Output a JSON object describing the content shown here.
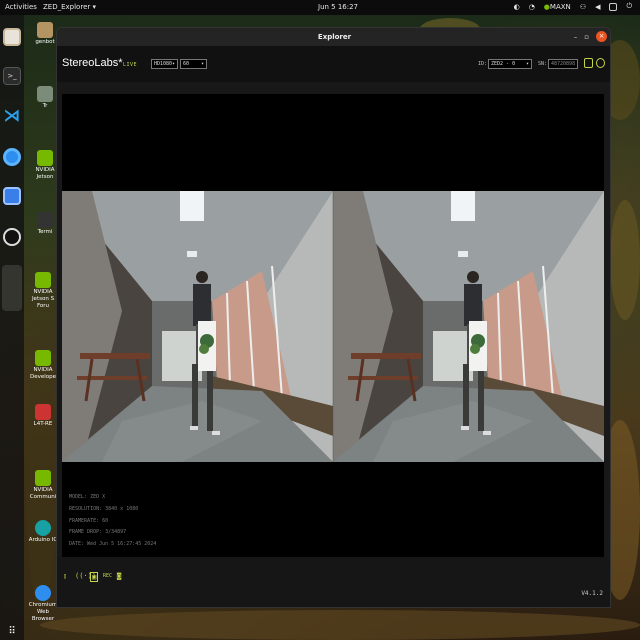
{
  "topbar": {
    "activities": "Activities",
    "app_menu": "ZED_Explorer",
    "clock": "Jun 5  16:27",
    "tray_text": "MAXN"
  },
  "desktop_icons": [
    {
      "label": "genbot"
    },
    {
      "label": "Tr"
    },
    {
      "label": "NVIDIA Jetson"
    },
    {
      "label": "Termi"
    },
    {
      "label": "NVIDIA Jetson S Foru"
    },
    {
      "label": "NVIDIA Develope"
    },
    {
      "label": "L4T-RE"
    },
    {
      "label": "NVIDIA Communi"
    },
    {
      "label": "Arduino IC"
    },
    {
      "label": "Chromium Web Browser"
    }
  ],
  "window": {
    "title": "Explorer",
    "logo": "StereoLabs*",
    "live": "LIVE",
    "resolution_select": "HD1080",
    "fps_select": "60",
    "id_label": "ID:",
    "camera_select": "ZED2 - 0",
    "sn_label": "SN:",
    "sn_value": "48720898",
    "info": {
      "model": "MODEL: ZED X",
      "resolution": "RESOLUTION: 3840 x 1080",
      "framerate": "FRAMERATE: 60",
      "frame_drop": "FRAME DROP: 3/34897",
      "date": "DATE: Wed Jun 5 16:27:45 2024"
    },
    "footer_rec": "REC",
    "version": "V4.1.2"
  },
  "colors": {
    "accent": "#c6d44a",
    "close": "#e95420",
    "window_bg": "#181818"
  }
}
